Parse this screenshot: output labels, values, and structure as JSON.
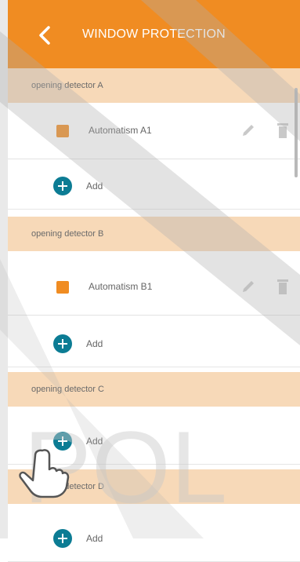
{
  "header": {
    "title": "WINDOW PROTECTION",
    "back_icon": "chevron-left-icon"
  },
  "sections": [
    {
      "label": "opening detector A",
      "items": [
        {
          "label": "Automatism A1"
        }
      ],
      "add_label": "Add"
    },
    {
      "label": "opening detector B",
      "items": [
        {
          "label": "Automatism B1"
        }
      ],
      "add_label": "Add"
    },
    {
      "label": "opening detector C",
      "items": [],
      "add_label": "Add"
    },
    {
      "label": "opening detector D",
      "items": [],
      "add_label": "Add"
    }
  ],
  "watermark": {
    "text": "POL"
  },
  "colors": {
    "accent": "#f08c22",
    "section_bg": "#f7d9b8",
    "add_button": "#0c7c94"
  }
}
